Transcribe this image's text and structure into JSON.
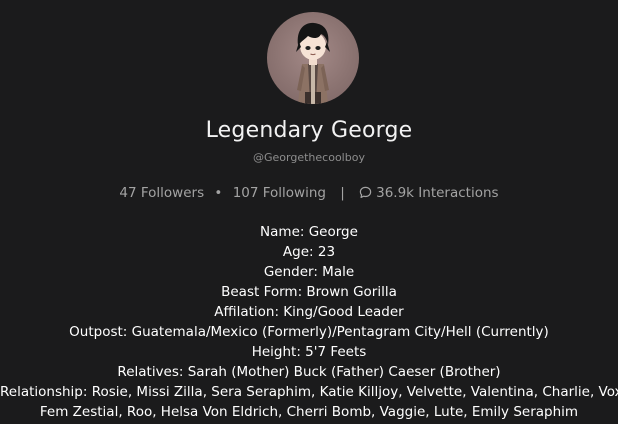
{
  "profile": {
    "display_name": "Legendary George",
    "handle": "@Georgethecoolboy",
    "avatar_icon": "gacha-character-avatar"
  },
  "stats": {
    "followers": "47 Followers",
    "dot": "•",
    "following": "107 Following",
    "separator": "|",
    "interactions": "36.9k Interactions",
    "interactions_icon": "chat-bubble-icon"
  },
  "bio": {
    "lines": [
      "Name: George",
      "Age: 23",
      "Gender: Male",
      "Beast Form: Brown Gorilla",
      "Affilation: King/Good Leader",
      "Outpost: Guatemala/Mexico (Formerly)/Pentagram City/Hell (Currently)",
      "Height: 5'7 Feets",
      "Relatives: Sarah (Mother) Buck (Father) Caeser (Brother)",
      "Relationship: Rosie, Missi Zilla, Sera Seraphim, Katie Killjoy, Velvette, Valentina, Charlie, Voxie,",
      "Fem Zestial, Roo, Helsa Von Eldrich, Cherri Bomb, Vaggie, Lute, Emily Seraphim"
    ]
  },
  "colors": {
    "background": "#1b1b1c",
    "text": "#ffffff",
    "muted": "#a3a3a3"
  }
}
